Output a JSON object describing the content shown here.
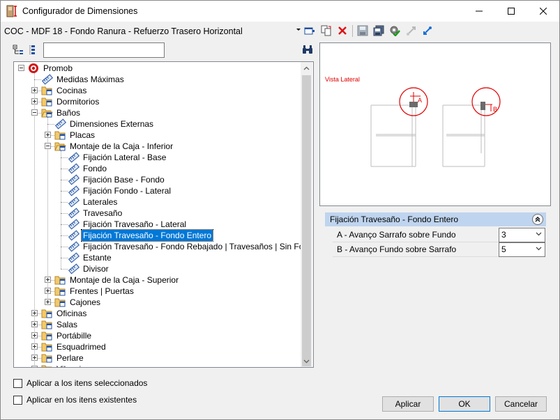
{
  "window": {
    "title": "Configurador de Dimensiones"
  },
  "toolbar": {
    "config_value": "COC - MDF 18 - Fondo Ranura - Refuerzo Trasero Horizontal"
  },
  "tree": {
    "search_value": "",
    "items": [
      {
        "label": "Promob",
        "depth": 0,
        "icon": "promob-logo-icon",
        "expander": "minus"
      },
      {
        "label": "Medidas Máximas",
        "depth": 1,
        "icon": "ruler-icon",
        "expander": "none"
      },
      {
        "label": "Cocinas",
        "depth": 1,
        "icon": "folder-icon",
        "expander": "plus"
      },
      {
        "label": "Dormitorios",
        "depth": 1,
        "icon": "folder-icon",
        "expander": "plus"
      },
      {
        "label": "Baños",
        "depth": 1,
        "icon": "folder-open-icon",
        "expander": "minus"
      },
      {
        "label": "Dimensiones Externas",
        "depth": 2,
        "icon": "ruler-icon",
        "expander": "none"
      },
      {
        "label": "Placas",
        "depth": 2,
        "icon": "folder-icon",
        "expander": "plus"
      },
      {
        "label": "Montaje de la Caja - Inferior",
        "depth": 2,
        "icon": "folder-open-icon",
        "expander": "minus"
      },
      {
        "label": "Fijación Lateral - Base",
        "depth": 3,
        "icon": "ruler-icon",
        "expander": "none"
      },
      {
        "label": "Fondo",
        "depth": 3,
        "icon": "ruler-icon",
        "expander": "none"
      },
      {
        "label": " Fijación Base - Fondo",
        "depth": 3,
        "icon": "ruler-icon",
        "expander": "none"
      },
      {
        "label": "Fijación Fondo - Lateral",
        "depth": 3,
        "icon": "ruler-icon",
        "expander": "none"
      },
      {
        "label": "Laterales",
        "depth": 3,
        "icon": "ruler-icon",
        "expander": "none"
      },
      {
        "label": "Travesaño",
        "depth": 3,
        "icon": "ruler-icon",
        "expander": "none"
      },
      {
        "label": "Fijación Travesaño - Lateral",
        "depth": 3,
        "icon": "ruler-icon",
        "expander": "none"
      },
      {
        "label": "Fijación Travesaño - Fondo Entero",
        "depth": 3,
        "icon": "ruler-icon",
        "expander": "none",
        "selected": true
      },
      {
        "label": "Fijación Travesaño - Fondo Rebajado | Travesaños | Sin Fondo",
        "depth": 3,
        "icon": "ruler-icon",
        "expander": "none"
      },
      {
        "label": "Estante",
        "depth": 3,
        "icon": "ruler-icon",
        "expander": "none"
      },
      {
        "label": "Divisor",
        "depth": 3,
        "icon": "ruler-icon",
        "expander": "none"
      },
      {
        "label": "Montaje de la Caja - Superior",
        "depth": 2,
        "icon": "folder-icon",
        "expander": "plus"
      },
      {
        "label": "Frentes | Puertas",
        "depth": 2,
        "icon": "folder-icon",
        "expander": "plus"
      },
      {
        "label": "Cajones",
        "depth": 2,
        "icon": "folder-icon",
        "expander": "plus"
      },
      {
        "label": "Oficinas",
        "depth": 1,
        "icon": "folder-icon",
        "expander": "plus"
      },
      {
        "label": "Salas",
        "depth": 1,
        "icon": "folder-icon",
        "expander": "plus"
      },
      {
        "label": "Portábille",
        "depth": 1,
        "icon": "folder-icon",
        "expander": "plus"
      },
      {
        "label": "Esquadrimed",
        "depth": 1,
        "icon": "folder-icon",
        "expander": "plus"
      },
      {
        "label": "Perlare",
        "depth": 1,
        "icon": "folder-icon",
        "expander": "plus"
      },
      {
        "label": "Vilaceia",
        "depth": 1,
        "icon": "folder-icon",
        "expander": "plus"
      }
    ]
  },
  "preview": {
    "label": "Vista Lateral",
    "marker_a": "A",
    "marker_b": "B"
  },
  "properties": {
    "header": "Fijación Travesaño - Fondo Entero",
    "rows": [
      {
        "name": "A - Avanço Sarrafo sobre Fundo",
        "value": "3"
      },
      {
        "name": "B - Avanço Fundo sobre Sarrafo",
        "value": "5"
      }
    ]
  },
  "options": {
    "apply_selected": "Aplicar a los itens seleccionados",
    "apply_existing": "Aplicar en los itens existentes"
  },
  "buttons": {
    "apply": "Aplicar",
    "ok": "OK",
    "cancel": "Cancelar"
  },
  "colors": {
    "selection": "#0078d7",
    "prop_header": "#bfd4ee",
    "preview_red": "#e00000"
  }
}
